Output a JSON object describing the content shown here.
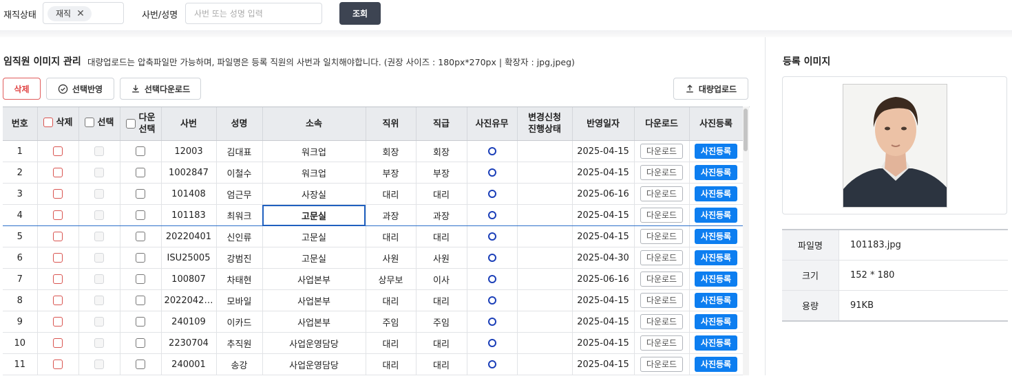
{
  "filter": {
    "status_label": "재직상태",
    "status_chip": "재직",
    "chip_remove": "✕",
    "emp_label": "사번/성명",
    "emp_placeholder": "사번 또는 성명 입력",
    "search_button": "조회"
  },
  "section": {
    "title": "임직원 이미지 관리",
    "description": "대량업로드는 압축파일만 가능하며, 파일명은 등록 직원의 사번과 일치해야합니다. (권장 사이즈 : 180px*270px | 확장자 : jpg,jpeg)"
  },
  "toolbar": {
    "delete": "삭제",
    "apply": "선택반영",
    "download_selected": "선택다운로드",
    "bulk_upload": "대량업로드"
  },
  "table": {
    "headers": {
      "no": "번호",
      "delete": "삭제",
      "select": "선택",
      "download_select_1": "다운",
      "download_select_2": "선택",
      "emp_no": "사번",
      "name": "성명",
      "dept": "소속",
      "position": "직위",
      "grade": "직급",
      "has_photo": "사진유무",
      "change_req_1": "변경신청",
      "change_req_2": "진행상태",
      "applied_date": "반영일자",
      "download": "다운로드",
      "register": "사진등록"
    },
    "download_label": "다운로드",
    "register_label": "사진등록",
    "selected_row": 4,
    "rows": [
      {
        "no": "1",
        "emp_no": "12003",
        "name": "김대표",
        "dept": "워크업",
        "position": "회장",
        "grade": "회장",
        "has_photo": true,
        "status": "",
        "date": "2025-04-15"
      },
      {
        "no": "2",
        "emp_no": "1002847",
        "name": "이철수",
        "dept": "워크업",
        "position": "부장",
        "grade": "부장",
        "has_photo": true,
        "status": "",
        "date": "2025-04-15"
      },
      {
        "no": "3",
        "emp_no": "101408",
        "name": "엄근무",
        "dept": "사장실",
        "position": "대리",
        "grade": "대리",
        "has_photo": true,
        "status": "",
        "date": "2025-06-16"
      },
      {
        "no": "4",
        "emp_no": "101183",
        "name": "최워크",
        "dept": "고문실",
        "position": "과장",
        "grade": "과장",
        "has_photo": true,
        "status": "",
        "date": "2025-04-15"
      },
      {
        "no": "5",
        "emp_no": "20220401",
        "name": "신인류",
        "dept": "고문실",
        "position": "대리",
        "grade": "대리",
        "has_photo": true,
        "status": "",
        "date": "2025-04-15"
      },
      {
        "no": "6",
        "emp_no": "ISU25005",
        "name": "강범진",
        "dept": "고문실",
        "position": "사원",
        "grade": "사원",
        "has_photo": true,
        "status": "",
        "date": "2025-04-30"
      },
      {
        "no": "7",
        "emp_no": "100807",
        "name": "차태현",
        "dept": "사업본부",
        "position": "상무보",
        "grade": "이사",
        "has_photo": true,
        "status": "",
        "date": "2025-06-16"
      },
      {
        "no": "8",
        "emp_no": "2022042…",
        "name": "모바일",
        "dept": "사업본부",
        "position": "대리",
        "grade": "대리",
        "has_photo": true,
        "status": "",
        "date": "2025-04-15"
      },
      {
        "no": "9",
        "emp_no": "240109",
        "name": "이카드",
        "dept": "사업본부",
        "position": "주임",
        "grade": "주임",
        "has_photo": true,
        "status": "",
        "date": "2025-04-15"
      },
      {
        "no": "10",
        "emp_no": "2230704",
        "name": "추직원",
        "dept": "사업운영담당",
        "position": "대리",
        "grade": "대리",
        "has_photo": true,
        "status": "",
        "date": "2025-04-15"
      },
      {
        "no": "11",
        "emp_no": "240001",
        "name": "송강",
        "dept": "사업운영담당",
        "position": "대리",
        "grade": "대리",
        "has_photo": true,
        "status": "",
        "date": "2025-04-15"
      }
    ]
  },
  "preview": {
    "title": "등록 이미지",
    "file_label": "파일명",
    "file_value": "101183.jpg",
    "size_label": "크기",
    "size_value": "152 * 180",
    "volume_label": "용량",
    "volume_value": "91KB"
  },
  "colors": {
    "primary_blue": "#0d7ef0",
    "dark_button": "#3d4452",
    "delete_red": "#e04545",
    "selected_border": "#2b6fc9"
  }
}
